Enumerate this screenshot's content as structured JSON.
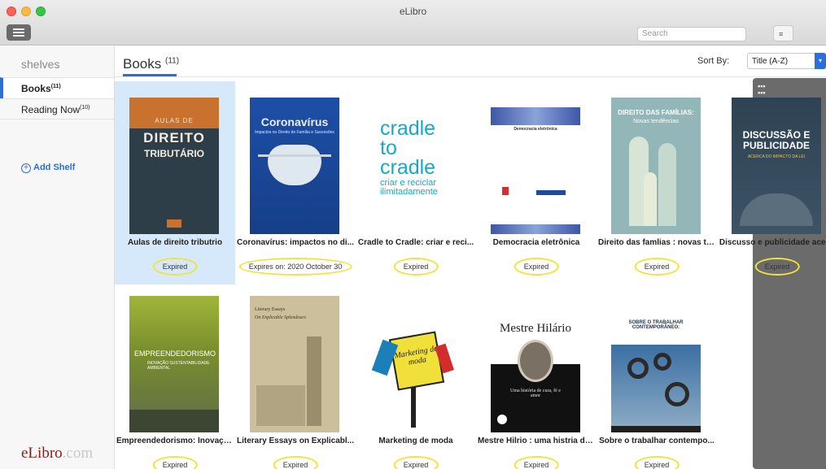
{
  "window": {
    "title": "eLibro"
  },
  "toolbar": {
    "search_placeholder": "Search"
  },
  "sidebar": {
    "heading": "shelves",
    "items": [
      {
        "label": "Books",
        "count": "(11)"
      },
      {
        "label": "Reading Now",
        "count": "(10)"
      }
    ],
    "add_shelf": "Add Shelf",
    "logo_main": "eLibro",
    "logo_suffix": ".com"
  },
  "main": {
    "title": "Books",
    "count": "(11)",
    "sort_label": "Sort By:",
    "sort_value": "Title (A-Z)"
  },
  "books": [
    {
      "title": "Aulas de direito tributrio",
      "status": "Expired",
      "cover": {
        "top": "AULAS DE",
        "main": "DIREITO",
        "sub": "TRIBUTÁRIO"
      }
    },
    {
      "title": "Coronavírus: impactos no di...",
      "status": "Expires on: 2020 October 30",
      "cover": {
        "main": "Coronavírus",
        "sub": "Impactos no Direito de Família e Sucessões"
      }
    },
    {
      "title": "Cradle to Cradle: criar e reci...",
      "status": "Expired",
      "cover": {
        "main": "cradle to cradle",
        "sub": "criar e reciclar ilimitadamente"
      }
    },
    {
      "title": "Democracia eletrônica",
      "status": "Expired",
      "cover": {
        "main": "Democracia eletrônica"
      }
    },
    {
      "title": "Direito das famlias : novas te...",
      "status": "Expired",
      "cover": {
        "main": "DIREITO DAS FAMÍLIAS:",
        "sub": "Novas tendências"
      }
    },
    {
      "title": "Discusso e publicidade acer...",
      "status": "Expired",
      "cover": {
        "main": "DISCUSSÃO E PUBLICIDADE",
        "sub": "ACERCA DO IMPACTO DA LEI"
      }
    },
    {
      "title": "Empreendedorismo: Inovaçã...",
      "status": "Expired",
      "cover": {
        "main": "EMPREENDEDORISMO",
        "sub": "INOVAÇÃO SUSTENTABILIDADE AMBIENTAL"
      }
    },
    {
      "title": "Literary Essays on Explicabl...",
      "status": "Expired",
      "cover": {
        "top": "Literary Essays",
        "main": "On Explicable Splendours"
      }
    },
    {
      "title": "Marketing de moda",
      "status": "Expired",
      "cover": {
        "main": "Marketing de moda"
      }
    },
    {
      "title": "Mestre Hilrio : uma histria de...",
      "status": "Expired",
      "cover": {
        "main": "Mestre Hilário",
        "sub": "Uma história de cura, fé e amor"
      }
    },
    {
      "title": "Sobre o trabalhar contempo...",
      "status": "Expired",
      "cover": {
        "main": "SOBRE O TRABALHAR CONTEMPORÂNEO:"
      }
    }
  ]
}
